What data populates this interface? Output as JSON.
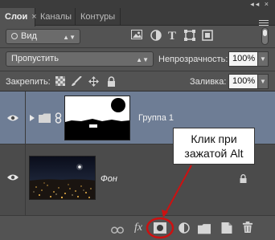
{
  "tabs": [
    {
      "label": "Слои",
      "active": true
    },
    {
      "label": "Каналы",
      "active": false
    },
    {
      "label": "Контуры",
      "active": false
    }
  ],
  "tab_close": "×",
  "panel_icons": "◂◂ ×",
  "filter": {
    "label": "Вид",
    "icons": [
      "image-filter-icon",
      "adjustment-filter-icon",
      "type-filter-icon",
      "shape-filter-icon",
      "smart-object-filter-icon"
    ],
    "type_glyph": "T"
  },
  "blend_mode": "Пропустить",
  "opacity": {
    "label": "Непрозрачность:",
    "value": "100%"
  },
  "lock": {
    "label": "Закрепить:"
  },
  "fill": {
    "label": "Заливка:",
    "value": "100%"
  },
  "layers": [
    {
      "name": "Группа 1",
      "selected": true,
      "type": "group"
    },
    {
      "name": "Фон",
      "selected": false,
      "type": "background",
      "locked": true
    }
  ],
  "bottom_toolbar": {
    "icons": [
      "link-layers-icon",
      "fx-icon",
      "add-mask-icon",
      "adjustment-layer-icon",
      "new-group-icon",
      "new-layer-icon",
      "delete-layer-icon"
    ],
    "fx_label": "fx"
  },
  "callout": {
    "line1": "Клик при",
    "line2": "зажатой Alt"
  },
  "colors": {
    "panel": "#535353",
    "selected": "#6e7d95",
    "annotation": "#cc1111"
  }
}
